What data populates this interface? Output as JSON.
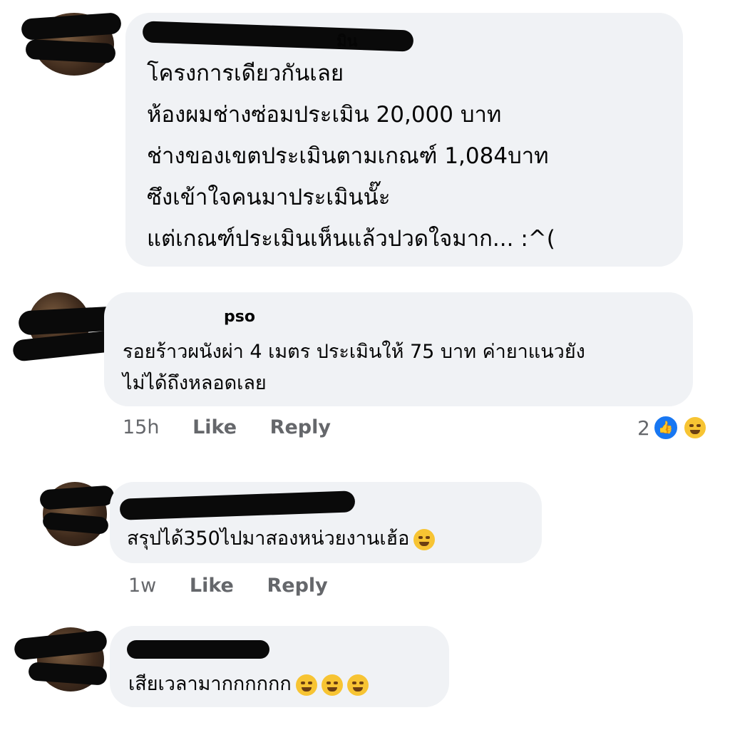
{
  "comments": [
    {
      "name_fragment": "มิน",
      "lines": [
        "โครงการเดียวกันเลย",
        "ห้องผมช่างซ่อมประเมิน 20,000 บาท",
        "ช่างของเขตประเมินตามเกณฑ์ 1,084บาท",
        "ซึงเข้าใจคนมาประเมินนั๊ะ",
        "แต่เกณฑ์ประเมินเห็นแล้วปวดใจมาก...  :^("
      ]
    },
    {
      "name_fragment": "pso",
      "lines": [
        "รอยร้าวผนังผ่า 4 เมตร ประเมินให้ 75 บาท ค่ายาแนวยัง",
        "ไม่ได้ถึงหลอดเลย"
      ],
      "time": "15h",
      "like_label": "Like",
      "reply_label": "Reply",
      "reaction_count": "2",
      "reaction_icons": [
        "like-icon",
        "haha-icon"
      ]
    },
    {
      "lines": [
        "สรุปได้350ไปมาสองหน่วยงานเฮ้อ"
      ],
      "emoji": [
        "face-holding-back-tears-icon"
      ],
      "time": "1w",
      "like_label": "Like",
      "reply_label": "Reply"
    },
    {
      "lines": [
        "เสียเวลามากกกกกก"
      ],
      "emoji": [
        "rolling-laughing-icon",
        "rolling-laughing-icon",
        "rolling-laughing-icon"
      ]
    }
  ],
  "colors": {
    "bubble": "#f0f2f5",
    "meta": "#65676b",
    "like": "#1877f2",
    "emoji": "#f7c433"
  }
}
